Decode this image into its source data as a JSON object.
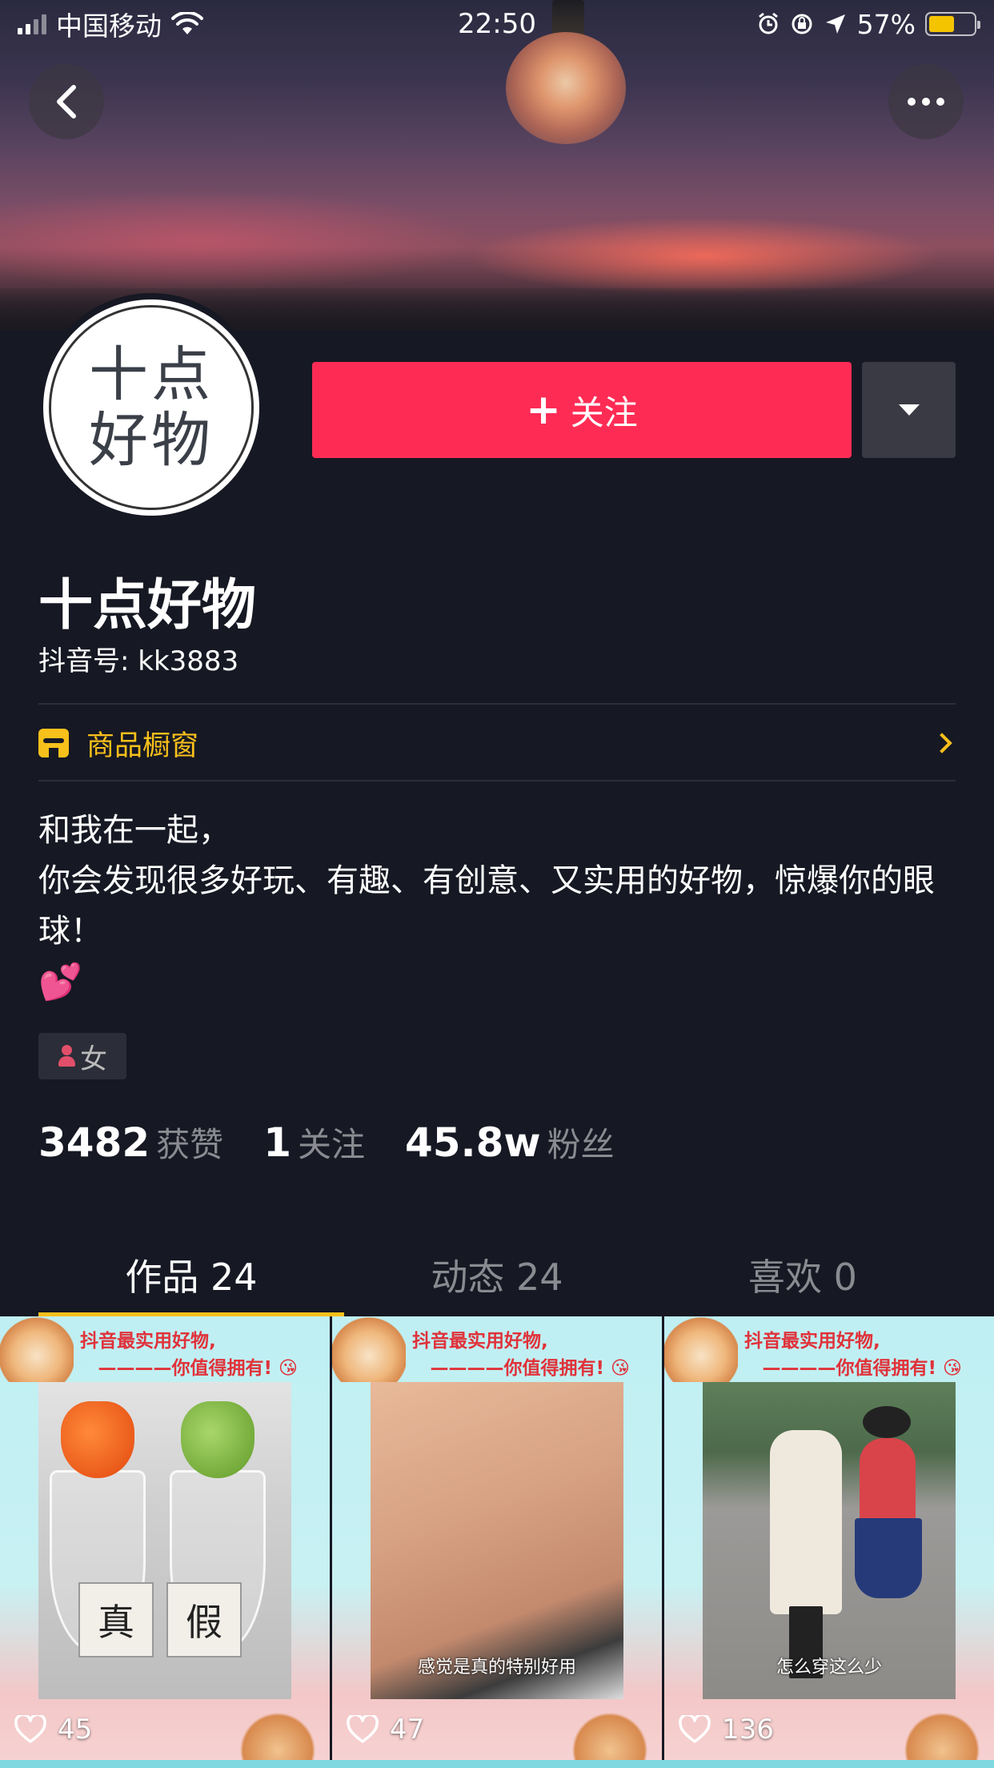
{
  "status_bar": {
    "carrier": "中国移动",
    "time": "22:50",
    "battery": "57%",
    "battery_level": 0.57
  },
  "icons": {
    "back": "chevron-left-icon",
    "more": "more-dots-icon",
    "dropdown": "caret-down-icon",
    "shop": "shop-icon",
    "like": "heart-icon"
  },
  "profile": {
    "avatar_line1": "十点",
    "avatar_line2": "好物",
    "follow_label": "关注",
    "name": "十点好物",
    "douyin_id": "抖音号: kk3883",
    "shop_label": "商品橱窗",
    "bio_line1": "和我在一起，",
    "bio_line2": "你会发现很多好玩、有趣、有创意、又实用的好物，惊爆你的眼球！",
    "bio_emoji": "💕",
    "gender": "女"
  },
  "stats": [
    {
      "num": "3482",
      "label": "获赞"
    },
    {
      "num": "1",
      "label": "关注"
    },
    {
      "num": "45.8w",
      "label": "粉丝"
    }
  ],
  "tabs": [
    {
      "label": "作品 24",
      "active": true
    },
    {
      "label": "动态 24",
      "active": false
    },
    {
      "label": "喜欢 0",
      "active": false
    }
  ],
  "videos": [
    {
      "head1": "抖音最实用好物,",
      "head2": "————你值得拥有! 😘",
      "tag1": "真",
      "tag2": "假",
      "subtitle": "",
      "likes": "45"
    },
    {
      "head1": "抖音最实用好物,",
      "head2": "————你值得拥有! 😘",
      "subtitle": "感觉是真的特别好用",
      "likes": "47"
    },
    {
      "head1": "抖音最实用好物,",
      "head2": "————你值得拥有! 😘",
      "subtitle": "怎么穿这么少",
      "likes": "136"
    }
  ],
  "colors": {
    "background": "#161823",
    "follow_button": "#fe2c55",
    "accent_yellow": "#f8c01b"
  }
}
